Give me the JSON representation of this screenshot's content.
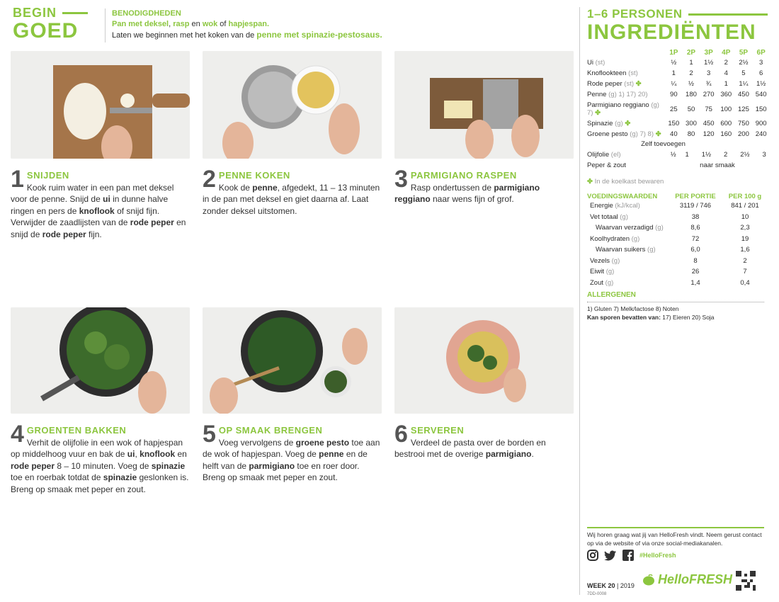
{
  "header": {
    "begin_line1": "BEGIN",
    "begin_line2": "GOED",
    "needs_title": "BENODIGDHEDEN",
    "needs_items_1": "Pan met deksel",
    "needs_sep_1": ", ",
    "needs_items_2": "rasp",
    "needs_sep_2": " en ",
    "needs_items_3": "wok",
    "needs_sep_3": " of ",
    "needs_items_4": "hapjespan",
    "needs_end": ".",
    "intro_pre": "Laten we beginnen met het koken van de ",
    "intro_dish": "penne met spinazie-pestosaus."
  },
  "steps": [
    {
      "num": "1",
      "title": "SNIJDEN",
      "photo": "onion-cutting-photo"
    },
    {
      "num": "2",
      "title": "PENNE KOKEN",
      "photo": "penne-pot-photo"
    },
    {
      "num": "3",
      "title": "PARMIGIANO RASPEN",
      "photo": "grating-photo"
    },
    {
      "num": "4",
      "title": "GROENTEN BAKKEN",
      "photo": "wok-spinach-photo"
    },
    {
      "num": "5",
      "title": "OP SMAAK BRENGEN",
      "photo": "pesto-photo"
    },
    {
      "num": "6",
      "title": "SERVEREN",
      "photo": "plate-photo"
    }
  ],
  "step_text": {
    "s1": [
      "Kook ruim water in een pan met deksel voor de penne. Snijd de ",
      "ui",
      " in dunne halve ringen en pers de ",
      "knoflook",
      " of snijd fijn. Verwijder de zaadlijsten van de ",
      "rode peper",
      " en snijd de ",
      "rode peper",
      " fijn."
    ],
    "s2": [
      "Kook de ",
      "penne",
      ", afgedekt, 11 – 13 minuten in de pan met deksel en giet daarna af. Laat zonder deksel uitstomen."
    ],
    "s3": [
      "Rasp ondertussen de ",
      "parmigiano reggiano",
      " naar wens fijn of grof."
    ],
    "s4": [
      "Verhit de olijfolie in een wok of hapjespan op middelhoog vuur en bak de ",
      "ui",
      ", ",
      "knoflook",
      " en ",
      "rode peper",
      " 8 – 10 minuten. Voeg de ",
      "spinazie",
      " toe en roerbak totdat de ",
      "spinazie",
      " geslonken is. Breng op smaak met peper en zout."
    ],
    "s5": [
      "Voeg vervolgens de ",
      "groene pesto",
      " toe aan de wok of hapjespan. Voeg de ",
      "penne",
      " en de helft van de ",
      "parmigiano",
      " toe en roer door. Breng op smaak met peper en zout."
    ],
    "s6": [
      "Verdeel de pasta over de borden en bestrooi met de overige ",
      "parmigiano",
      "."
    ]
  },
  "ingredients": {
    "persons": "1–6 PERSONEN",
    "title": "INGREDIËNTEN",
    "columns": [
      "1P",
      "2P",
      "3P",
      "4P",
      "5P",
      "6P"
    ],
    "rows": [
      {
        "name": "Ui",
        "unit": "(st)",
        "mark": "",
        "values": [
          "½",
          "1",
          "1½",
          "2",
          "2½",
          "3"
        ]
      },
      {
        "name": "Knoflookteen",
        "unit": "(st)",
        "mark": "",
        "values": [
          "1",
          "2",
          "3",
          "4",
          "5",
          "6"
        ]
      },
      {
        "name": "Rode peper",
        "unit": "(st)",
        "mark": "✤",
        "values": [
          "¼",
          "½",
          "¾",
          "1",
          "1¼",
          "1½"
        ]
      },
      {
        "name": "Penne",
        "unit": "(g) 1) 17) 20)",
        "mark": "",
        "values": [
          "90",
          "180",
          "270",
          "360",
          "450",
          "540"
        ]
      },
      {
        "name": "Parmigiano reggiano",
        "unit": "(g) 7)",
        "mark": "✤",
        "values": [
          "25",
          "50",
          "75",
          "100",
          "125",
          "150"
        ]
      },
      {
        "name": "Spinazie",
        "unit": "(g)",
        "mark": "✤",
        "values": [
          "150",
          "300",
          "450",
          "600",
          "750",
          "900"
        ]
      },
      {
        "name": "Groene pesto",
        "unit": "(g) 7) 8)",
        "mark": "✤",
        "values": [
          "40",
          "80",
          "120",
          "160",
          "200",
          "240"
        ]
      }
    ],
    "zelf": "Zelf toevoegen",
    "rows2": [
      {
        "name": "Olijfolie",
        "unit": "(el)",
        "values": [
          "½",
          "1",
          "1½",
          "2",
          "2½",
          "3"
        ]
      }
    ],
    "peper_name": "Peper & zout",
    "peper_value": "naar smaak",
    "fridge_mark": "✤",
    "fridge": "In de koelkast bewaren"
  },
  "nutrition": {
    "head": "VOEDINGSWAARDEN",
    "col1": "PER PORTIE",
    "col2": "PER 100 g",
    "rows": [
      {
        "name": "Energie",
        "unit": "(kJ/kcal)",
        "v1": "3119 / 746",
        "v2": "841 / 201",
        "indent": false
      },
      {
        "name": "Vet totaal",
        "unit": "(g)",
        "v1": "38",
        "v2": "10",
        "indent": false
      },
      {
        "name": "Waarvan verzadigd",
        "unit": "(g)",
        "v1": "8,6",
        "v2": "2,3",
        "indent": true
      },
      {
        "name": "Koolhydraten",
        "unit": "(g)",
        "v1": "72",
        "v2": "19",
        "indent": false
      },
      {
        "name": "Waarvan suikers",
        "unit": "(g)",
        "v1": "6,0",
        "v2": "1,6",
        "indent": true
      },
      {
        "name": "Vezels",
        "unit": "(g)",
        "v1": "8",
        "v2": "2",
        "indent": false
      },
      {
        "name": "Eiwit",
        "unit": "(g)",
        "v1": "26",
        "v2": "7",
        "indent": false
      },
      {
        "name": "Zout",
        "unit": "(g)",
        "v1": "1,4",
        "v2": "0,4",
        "indent": false
      }
    ]
  },
  "allergens": {
    "head": "ALLERGENEN",
    "line1": "1) Gluten 7) Melk/lactose 8) Noten",
    "line2_label": "Kan sporen bevatten van:",
    "line2_value": "17) Eieren 20) Soja"
  },
  "footer": {
    "feedback": "Wij horen graag wat jij van HelloFresh vindt. Neem gerust contact op via de website of via onze social-mediakanalen.",
    "hashtag": "#HelloFresh",
    "week": "WEEK 20",
    "year": "| 2019",
    "code": "7DD-0008",
    "logo": "HelloFRESH"
  },
  "colors": {
    "accent": "#8cc63f",
    "text": "#2b2b2b"
  }
}
